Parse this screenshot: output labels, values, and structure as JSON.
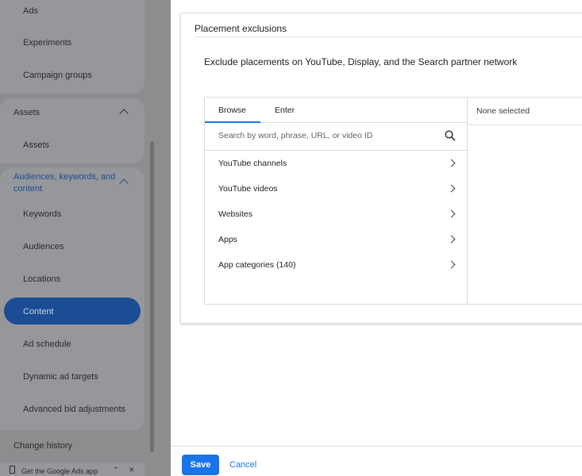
{
  "sidebar": {
    "items_top": [
      "Ads",
      "Experiments",
      "Campaign groups"
    ],
    "assets_header": "Assets",
    "assets_items": [
      "Assets"
    ],
    "audiences_header": "Audiences, keywords, and content",
    "audiences_items": [
      "Keywords",
      "Audiences",
      "Locations",
      "Content",
      "Ad schedule",
      "Dynamic ad targets",
      "Advanced bid adjustments"
    ],
    "selected": "Content",
    "change_history": "Change history",
    "app_banner": "Get the Google Ads app"
  },
  "panel": {
    "title": "Placement exclusions",
    "description": "Exclude placements on YouTube, Display, and the Search partner network",
    "tabs": [
      "Browse",
      "Enter"
    ],
    "search_placeholder": "Search by word, phrase, URL, or video ID",
    "categories": [
      "YouTube channels",
      "YouTube videos",
      "Websites",
      "Apps",
      "App categories (140)"
    ],
    "selected_label": "None selected"
  },
  "footer": {
    "save": "Save",
    "cancel": "Cancel"
  },
  "colors": {
    "accent": "#1a73e8"
  }
}
